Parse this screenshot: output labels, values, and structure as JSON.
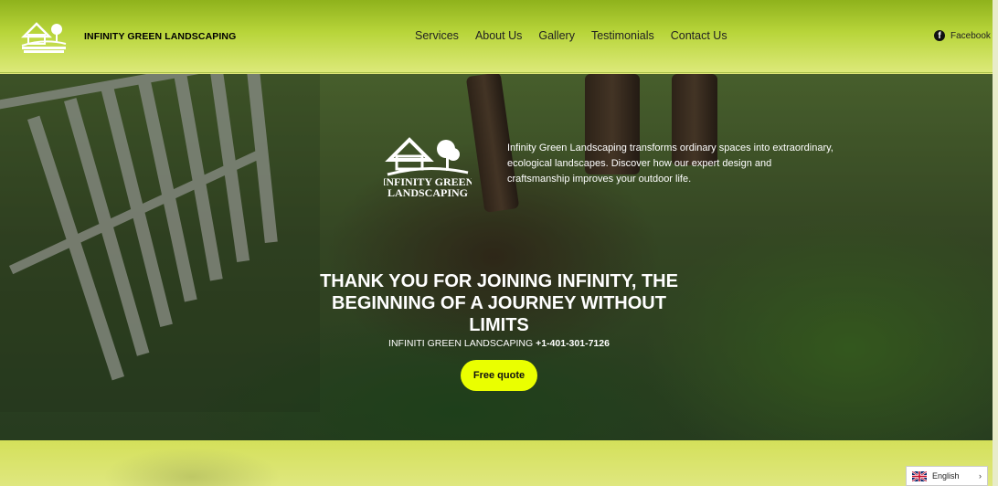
{
  "header": {
    "brand": "INFINITY GREEN LANDSCAPING",
    "nav": [
      {
        "label": "Services"
      },
      {
        "label": "About Us"
      },
      {
        "label": "Gallery"
      },
      {
        "label": "Testimonials"
      },
      {
        "label": "Contact Us"
      }
    ],
    "social": {
      "label": "Facebook",
      "icon": "facebook-icon"
    }
  },
  "hero": {
    "logo_text_line1": "INFINITY GREEN",
    "logo_text_line2": "LANDSCAPING",
    "description": "Infinity Green Landscaping transforms ordinary spaces into extraordinary, ecological landscapes. Discover how our expert design and craftsmanship improves your outdoor life.",
    "title": "THANK YOU FOR JOINING INFINITY, THE BEGINNING OF A JOURNEY WITHOUT LIMITS",
    "subtitle_prefix": "INFINITI GREEN LANDSCAPING ",
    "phone": "+1-401-301-7126",
    "cta_label": "Free quote"
  },
  "language": {
    "selected": "English",
    "icon": "uk-flag-icon"
  },
  "colors": {
    "accent": "#eaff00",
    "header_top": "#8fb21c",
    "header_bottom": "#dce979"
  }
}
